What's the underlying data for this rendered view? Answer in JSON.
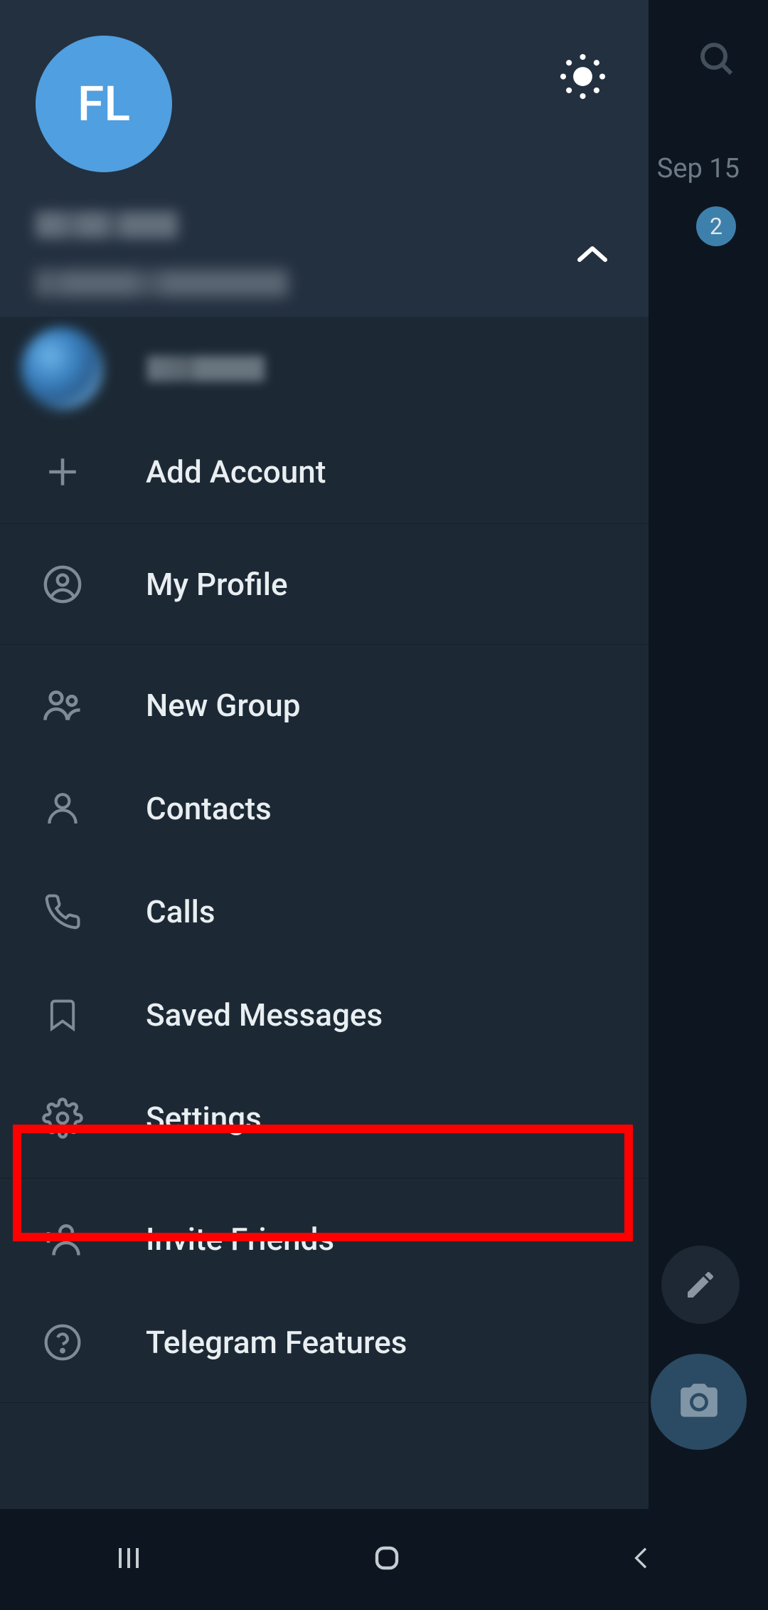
{
  "drawer": {
    "avatar_initials": "FL",
    "add_account_label": "Add Account",
    "menu": {
      "my_profile": "My Profile",
      "new_group": "New Group",
      "contacts": "Contacts",
      "calls": "Calls",
      "saved_messages": "Saved Messages",
      "settings": "Settings",
      "invite_friends": "Invite Friends",
      "telegram_features": "Telegram Features"
    }
  },
  "background": {
    "date": "Sep 15",
    "badge_count": "2"
  }
}
